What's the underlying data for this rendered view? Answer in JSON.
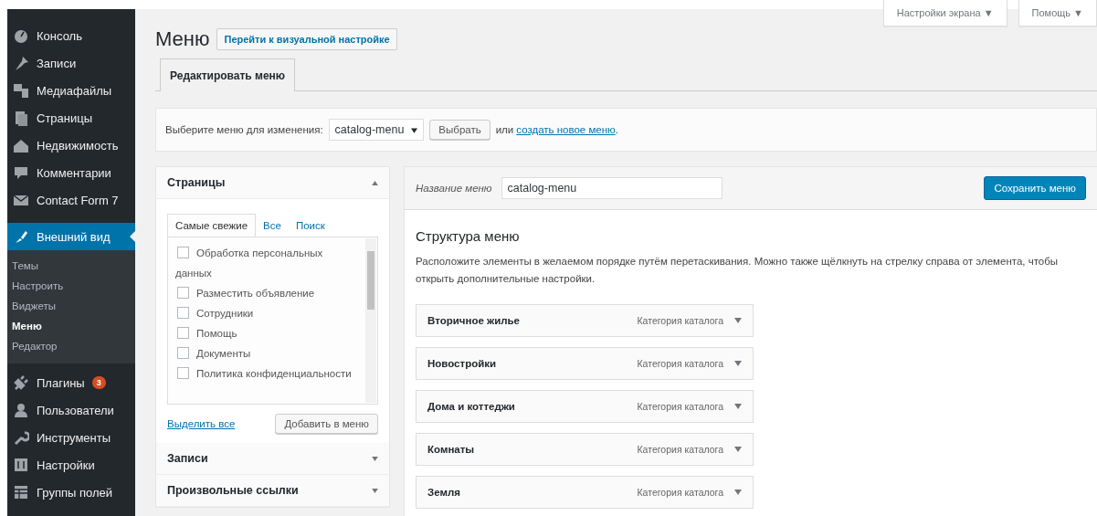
{
  "sidebar": {
    "items": [
      {
        "label": "Консоль",
        "selected": false
      },
      {
        "label": "Записи",
        "selected": false
      },
      {
        "label": "Медиафайлы",
        "selected": false
      },
      {
        "label": "Страницы",
        "selected": false
      },
      {
        "label": "Недвижимость",
        "selected": false
      },
      {
        "label": "Комментарии",
        "selected": false
      },
      {
        "label": "Contact Form 7",
        "selected": false
      },
      {
        "label": "Внешний вид",
        "selected": true,
        "children": [
          {
            "label": "Темы",
            "selected": false
          },
          {
            "label": "Настроить",
            "selected": false
          },
          {
            "label": "Виджеты",
            "selected": false
          },
          {
            "label": "Меню",
            "selected": true
          },
          {
            "label": "Редактор",
            "selected": false
          }
        ]
      },
      {
        "label": "Плагины",
        "selected": false,
        "badge": "3"
      },
      {
        "label": "Пользователи",
        "selected": false
      },
      {
        "label": "Инструменты",
        "selected": false
      },
      {
        "label": "Настройки",
        "selected": false
      },
      {
        "label": "Группы полей",
        "selected": false
      }
    ]
  },
  "screen_meta": [
    {
      "label": "Настройки экрана ▼"
    },
    {
      "label": "Помощь ▼"
    }
  ],
  "page": {
    "title": "Меню",
    "action_button": "Перейти к визуальной настройке"
  },
  "tabs": [
    {
      "label": "Редактировать меню",
      "selected": true
    }
  ],
  "select_bar": {
    "label": "Выберите меню для изменения:",
    "select_value": "catalog-menu",
    "button": "Выбрать",
    "or_text": "или",
    "link": "создать новое меню",
    "after_link": "."
  },
  "panels": [
    {
      "title": "Страницы",
      "expanded": true,
      "tabs": [
        {
          "label": "Самые свежие",
          "selected": true
        },
        {
          "label": "Все",
          "selected": false
        },
        {
          "label": "Поиск",
          "selected": false
        }
      ],
      "checklist": [
        {
          "label": "Обработка персональных данных",
          "checked": false
        },
        {
          "label": "Разместить объявление",
          "checked": false
        },
        {
          "label": "Сотрудники",
          "checked": false
        },
        {
          "label": "Помощь",
          "checked": false
        },
        {
          "label": "Документы",
          "checked": false
        },
        {
          "label": "Политика конфиденциальности",
          "checked": false
        }
      ],
      "select_all": "Выделить все",
      "add_button": "Добавить в меню"
    },
    {
      "title": "Записи",
      "expanded": false
    },
    {
      "title": "Произвольные ссылки",
      "expanded": false
    }
  ],
  "menu_editor": {
    "name_label": "Название меню",
    "name_value": "catalog-menu",
    "save_button": "Сохранить меню",
    "heading": "Структура меню",
    "description": "Расположите элементы в желаемом порядке путём перетаскивания. Можно также щёлкнуть на стрелку справа от элемента, чтобы открыть дополнительные настройки.",
    "items": [
      {
        "title": "Вторичное жилье",
        "type": "Категория каталога"
      },
      {
        "title": "Новостройки",
        "type": "Категория каталога"
      },
      {
        "title": "Дома и коттеджи",
        "type": "Категория каталога"
      },
      {
        "title": "Комнаты",
        "type": "Категория каталога"
      },
      {
        "title": "Земля",
        "type": "Категория каталога"
      }
    ]
  }
}
